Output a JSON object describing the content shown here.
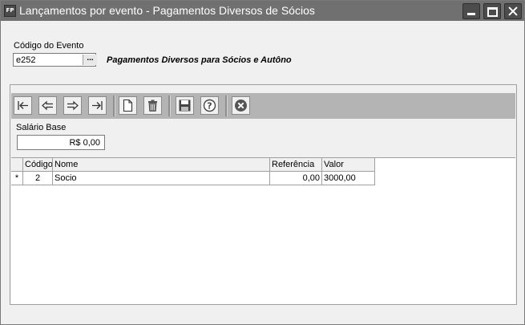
{
  "window": {
    "app_icon_text": "FP",
    "title": "Lançamentos por evento - Pagamentos Diversos de Sócios"
  },
  "header": {
    "codigo_label": "Código do Evento",
    "codigo_value": "e252",
    "lookup_label": "...",
    "event_description": "Pagamentos Diversos para Sócios e Autôno"
  },
  "toolbar": {
    "icons": [
      "first-record-icon",
      "previous-record-icon",
      "next-record-icon",
      "last-record-icon",
      "new-document-icon",
      "delete-trash-icon",
      "save-floppy-icon",
      "help-icon",
      "cancel-icon"
    ]
  },
  "form": {
    "salario_label": "Salário Base",
    "salario_value": "R$ 0,00"
  },
  "grid": {
    "columns": [
      "Código",
      "Nome",
      "Referência",
      "Valor"
    ],
    "rows": [
      {
        "indicator": "*",
        "codigo": "2",
        "nome": "Socio",
        "referencia": "0,00",
        "valor": "3000,00"
      }
    ]
  }
}
